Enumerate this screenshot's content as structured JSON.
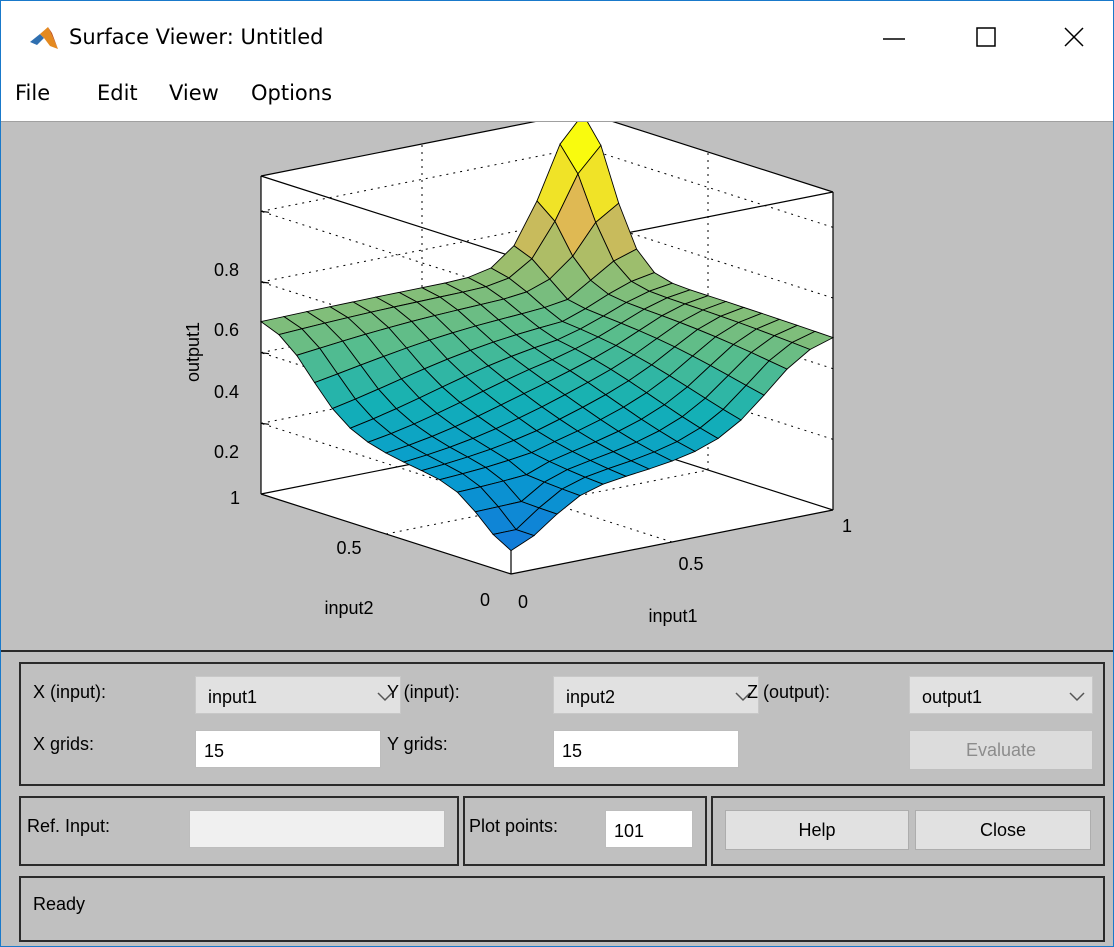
{
  "window": {
    "title": "Surface Viewer: Untitled",
    "icon": "matlab-icon"
  },
  "menu": [
    "File",
    "Edit",
    "View",
    "Options"
  ],
  "plot": {
    "zlabel": "output1",
    "xlabel": "input1",
    "ylabel": "input2",
    "z_ticks": [
      "0.8",
      "0.6",
      "0.4",
      "0.2"
    ],
    "x_ticks": [
      "0",
      "0.5",
      "1"
    ],
    "y_ticks": [
      "0",
      "0.5",
      "1"
    ],
    "colormap": "parula"
  },
  "chart_data": {
    "type": "surface",
    "xlabel": "input1",
    "ylabel": "input2",
    "zlabel": "output1",
    "xlim": [
      0,
      1
    ],
    "ylim": [
      0,
      1
    ],
    "zlim": [
      0,
      0.9
    ],
    "grid": true,
    "x_grids": 15,
    "y_grids": 15,
    "peak_at": {
      "input1": 1,
      "input2": 1,
      "output1": 0.88
    },
    "min_at": {
      "input1": 0,
      "input2": 0,
      "output1": 0.02
    },
    "edge_value_far_corners": 0.5
  },
  "controls": {
    "x_input_label": "X (input):",
    "x_input_value": "input1",
    "y_input_label": "Y (input):",
    "y_input_value": "input2",
    "z_output_label": "Z (output):",
    "z_output_value": "output1",
    "x_grids_label": "X grids:",
    "x_grids_value": "15",
    "y_grids_label": "Y grids:",
    "y_grids_value": "15",
    "evaluate_label": "Evaluate",
    "ref_input_label": "Ref. Input:",
    "ref_input_value": "",
    "plot_points_label": "Plot points:",
    "plot_points_value": "101",
    "help_label": "Help",
    "close_label": "Close"
  },
  "status": {
    "text": "Ready"
  }
}
